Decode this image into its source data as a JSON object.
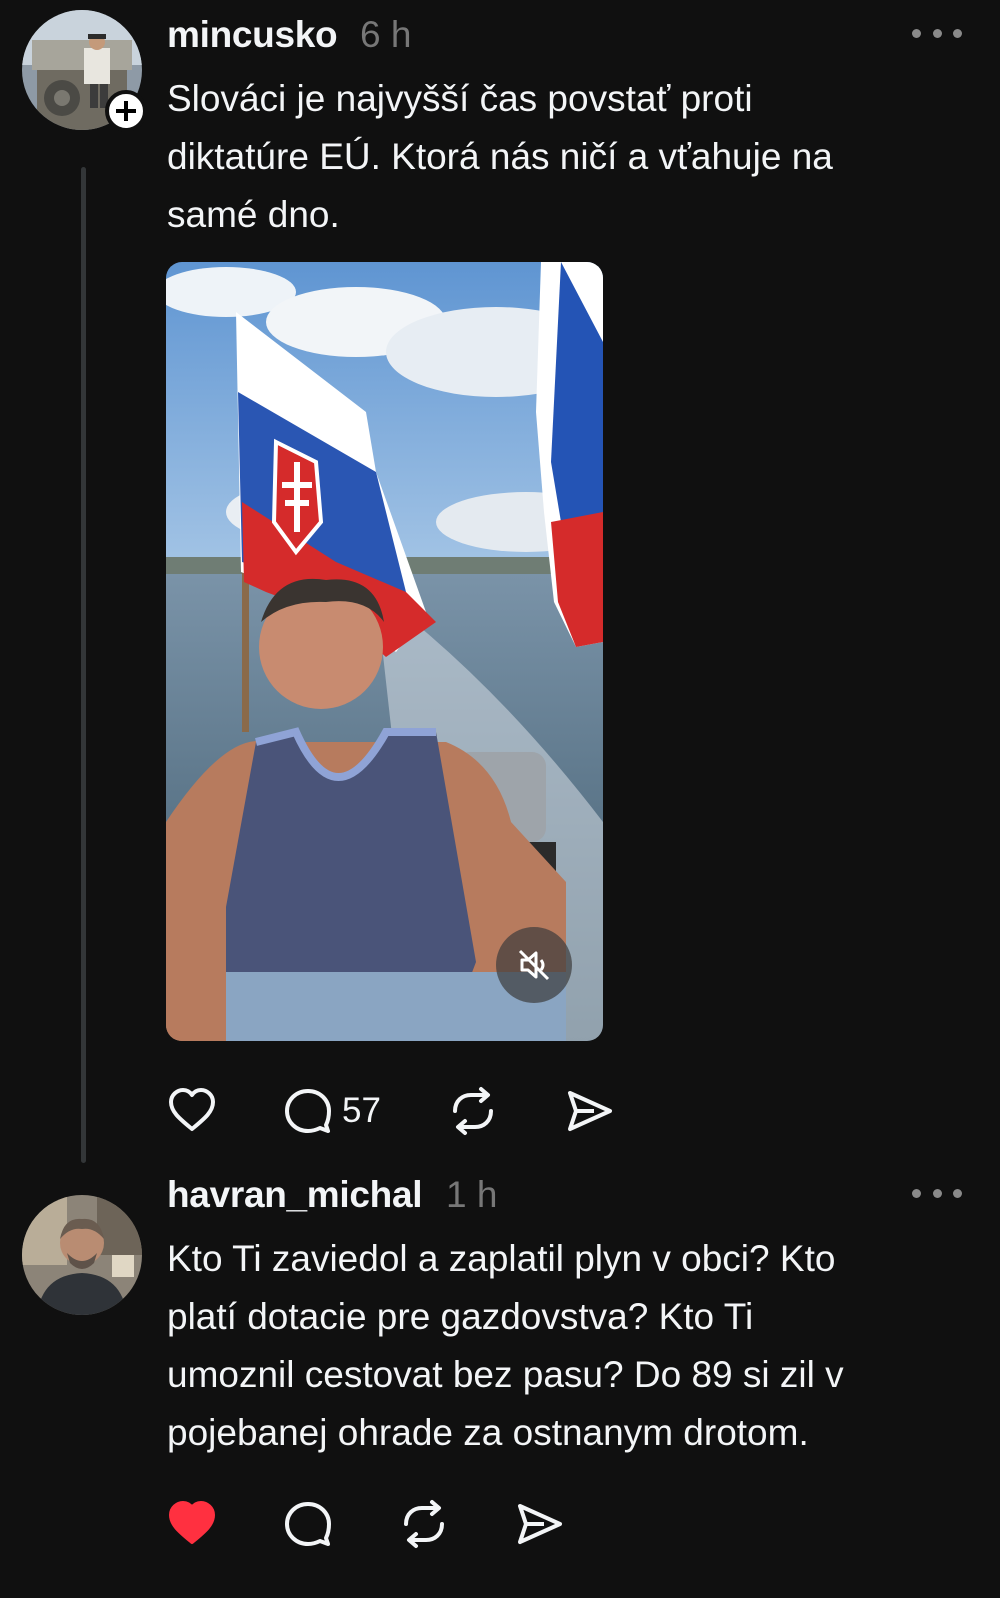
{
  "posts": [
    {
      "username": "mincusko",
      "time": "6 h",
      "text_lines": [
        "Slováci je najvyšší čas povstať proti",
        "diktatúre EÚ. Ktorá nás ničí a vťahuje na",
        "samé dno."
      ],
      "comments_count": "57",
      "liked": false
    },
    {
      "username": "havran_michal",
      "time": "1 h",
      "text_lines": [
        "Kto Ti zaviedol a zaplatil plyn v obci? Kto",
        "platí dotacie pre gazdovstva? Kto Ti",
        "umoznil cestovat bez pasu? Do 89 si zil v",
        "pojebanej ohrade za ostnanym drotom."
      ],
      "liked": true
    }
  ],
  "colors": {
    "background": "#101010",
    "text": "#f3f5f7",
    "muted": "#777777",
    "like_active": "#ff3040"
  },
  "icons": [
    "more-icon",
    "follow-plus-icon",
    "heart-icon",
    "comment-icon",
    "repost-icon",
    "share-icon",
    "muted-speaker-icon"
  ]
}
